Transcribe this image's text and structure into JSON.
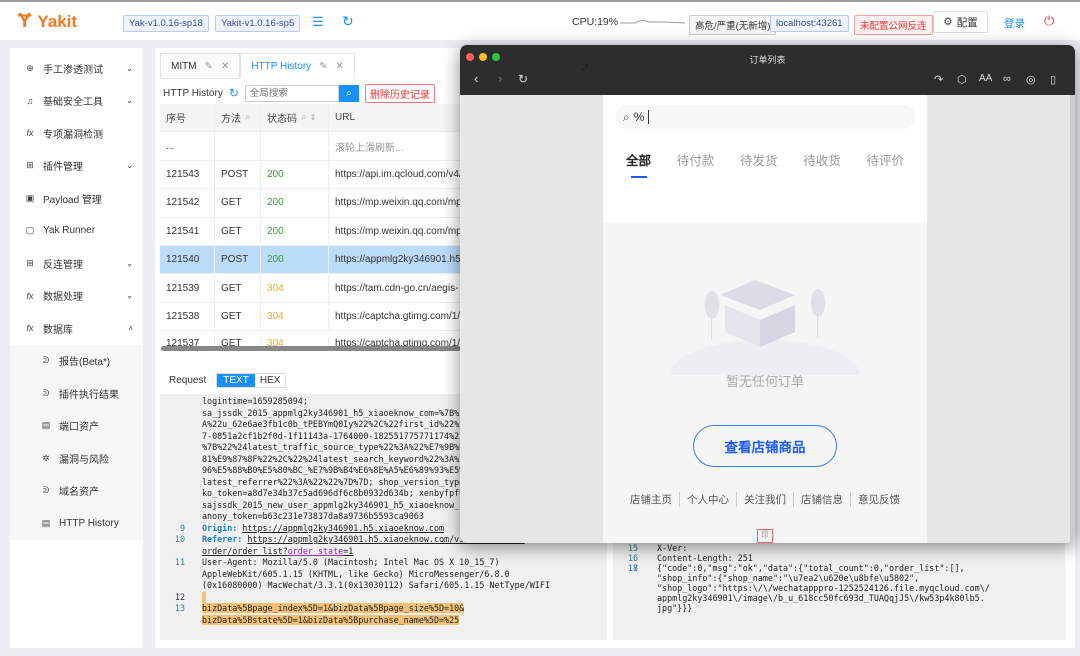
{
  "app": {
    "name": "Yakit",
    "versions": [
      "Yak-v1.0.16-sp18",
      "Yakit-v1.0.16-sp5"
    ],
    "cpu": "CPU:19%",
    "risk_badge": "高危/严重(无新增)",
    "host": "localhost:43261",
    "reverse_badge": "未配置公网反连",
    "config": "配置",
    "login": "登录"
  },
  "sidebar": {
    "items": [
      {
        "label": "手工渗透测试",
        "icon": "target-icon"
      },
      {
        "label": "基础安全工具",
        "icon": "bell-icon"
      },
      {
        "label": "专项漏洞检测",
        "icon": "fx-icon"
      },
      {
        "label": "插件管理",
        "icon": "grid-icon"
      },
      {
        "label": "Payload 管理",
        "icon": "doc-icon"
      },
      {
        "label": "Yak Runner",
        "icon": "terminal-icon"
      },
      {
        "label": "反连管理",
        "icon": "grid-icon"
      },
      {
        "label": "数据处理",
        "icon": "fx-icon"
      },
      {
        "label": "数据库",
        "icon": "fx-icon"
      }
    ],
    "sub": [
      "报告(Beta*)",
      "插件执行结果",
      "端口资产",
      "漏洞与风险",
      "域名资产",
      "HTTP History"
    ]
  },
  "tabs": [
    "MITM",
    "HTTP History"
  ],
  "history": {
    "title": "HTTP History",
    "search_placeholder": "全局搜索",
    "delete": "删除历史记录",
    "columns": [
      "序号",
      "方法",
      "状态码",
      "URL"
    ],
    "rows": [
      [
        "...",
        "",
        "",
        "滚轮上滑刷新..."
      ],
      [
        "121543",
        "POST",
        "200",
        "https://api.im.qcloud.com/v4/"
      ],
      [
        "121542",
        "GET",
        "200",
        "https://mp.weixin.qq.com/mp/"
      ],
      [
        "121541",
        "GET",
        "200",
        "https://mp.weixin.qq.com/mp/"
      ],
      [
        "121540",
        "POST",
        "200",
        "https://appmlg2ky346901.h5"
      ],
      [
        "121539",
        "GET",
        "304",
        "https://tam.cdn-go.cn/aegis-"
      ],
      [
        "121538",
        "GET",
        "304",
        "https://captcha.gtimg.com/1/"
      ],
      [
        "121537",
        "GET",
        "304",
        "https://captcha.gtimg.com/1/"
      ]
    ]
  },
  "request": {
    "label": "Request",
    "text": "TEXT",
    "hex": "HEX",
    "cookie_lines": [
      "logintime=1659285094;",
      "sa_jssdk_2015_appmlg2ky346901_h5_xiaoeknow_com=%7B%22",
      "A%22u_62e6ae3fb1c0b_tPEBYmQ0Iy%22%2C%22first_id%22%3A",
      "7-0851a2cf1b2f0d-1f11143a-1764000-182551775771174%22%",
      "%7B%22%24latest_traffic_source_type%22%3A%22%E7%9B%B4",
      "81%E9%87%8F%22%2C%22%24latest_search_keyword%22%3A%22",
      "96%E5%88%B0%E5%80%BC_%E7%9B%B4%E6%8E%A5%E6%89%93%E5%B",
      "latest_referrer%22%3A%22%22%7D%7D; shop_version_type=",
      "ko_token=a8d7e34b37c5ad696df6c8b0932d634b; xenbyfpfUn",
      "sajssdk_2015_new_user_appmlg2ky346901_h5_xiaoeknow_co",
      "anony_token=b63c231e73837da8a9736b5593ca9063"
    ],
    "origin_key": "Origin:",
    "origin": "https://appmlg2ky346901.h5.xiaoeknow.com",
    "referer_key": "Referer:",
    "referer1": "https://appmlg2ky346901.h5.xiaoeknow.com/v1/usercenter/",
    "referer2": "order/order_list?",
    "referer_param": "order_state",
    "referer_val": "=1",
    "ua": [
      "User-Agent: Mozilla/5.0 (Macintosh; Intel Mac OS X 10_15_7)",
      "AppleWebKit/605.1.15 (KHTML, like Gecko) MicroMessenger/6.8.0",
      "(0x16080000) MacWechat/3.3.1(0x13030112) Safari/605.1.15 NetType/WIFI"
    ],
    "body": [
      "bizData%5Bpage_index%5D=1&bizData%5Bpage_size%5D=10&",
      "bizData%5Bstate%5D=1&bizData%5Bpurchase_name%5D=%25"
    ],
    "line_numbers": [
      "9",
      "10",
      "11",
      "12",
      "13"
    ]
  },
  "response": {
    "line_numbers": [
      "15",
      "16",
      "17",
      "18"
    ],
    "lines": [
      "X-Ver:",
      "Content-Length: 251",
      "",
      "{\"code\":0,\"msg\":\"ok\",\"data\":{\"total_count\":0,\"order_list\":[],",
      "\"shop_info\":{\"shop_name\":\"\\u7ea2\\u620e\\u8bfe\\u5802\",",
      "\"shop_logo\":\"https:\\/\\/wechatapppro-1252524126.file.myqcloud.com\\/",
      "appmlg2ky346901\\/image\\/b_u_618cc50fc693d_TUAQqjJ5\\/kw53p4k80lb5.",
      "jpg\"}}}"
    ]
  },
  "window": {
    "title": "订单列表",
    "search_value": "%",
    "order_tabs": [
      "全部",
      "待付款",
      "待发货",
      "待收货",
      "待评价"
    ],
    "empty": "暂无任何订单",
    "view_shop": "查看店铺商品",
    "footer": [
      "店铺主页",
      "个人中心",
      "关注我们",
      "店铺信息",
      "意见反馈"
    ]
  }
}
